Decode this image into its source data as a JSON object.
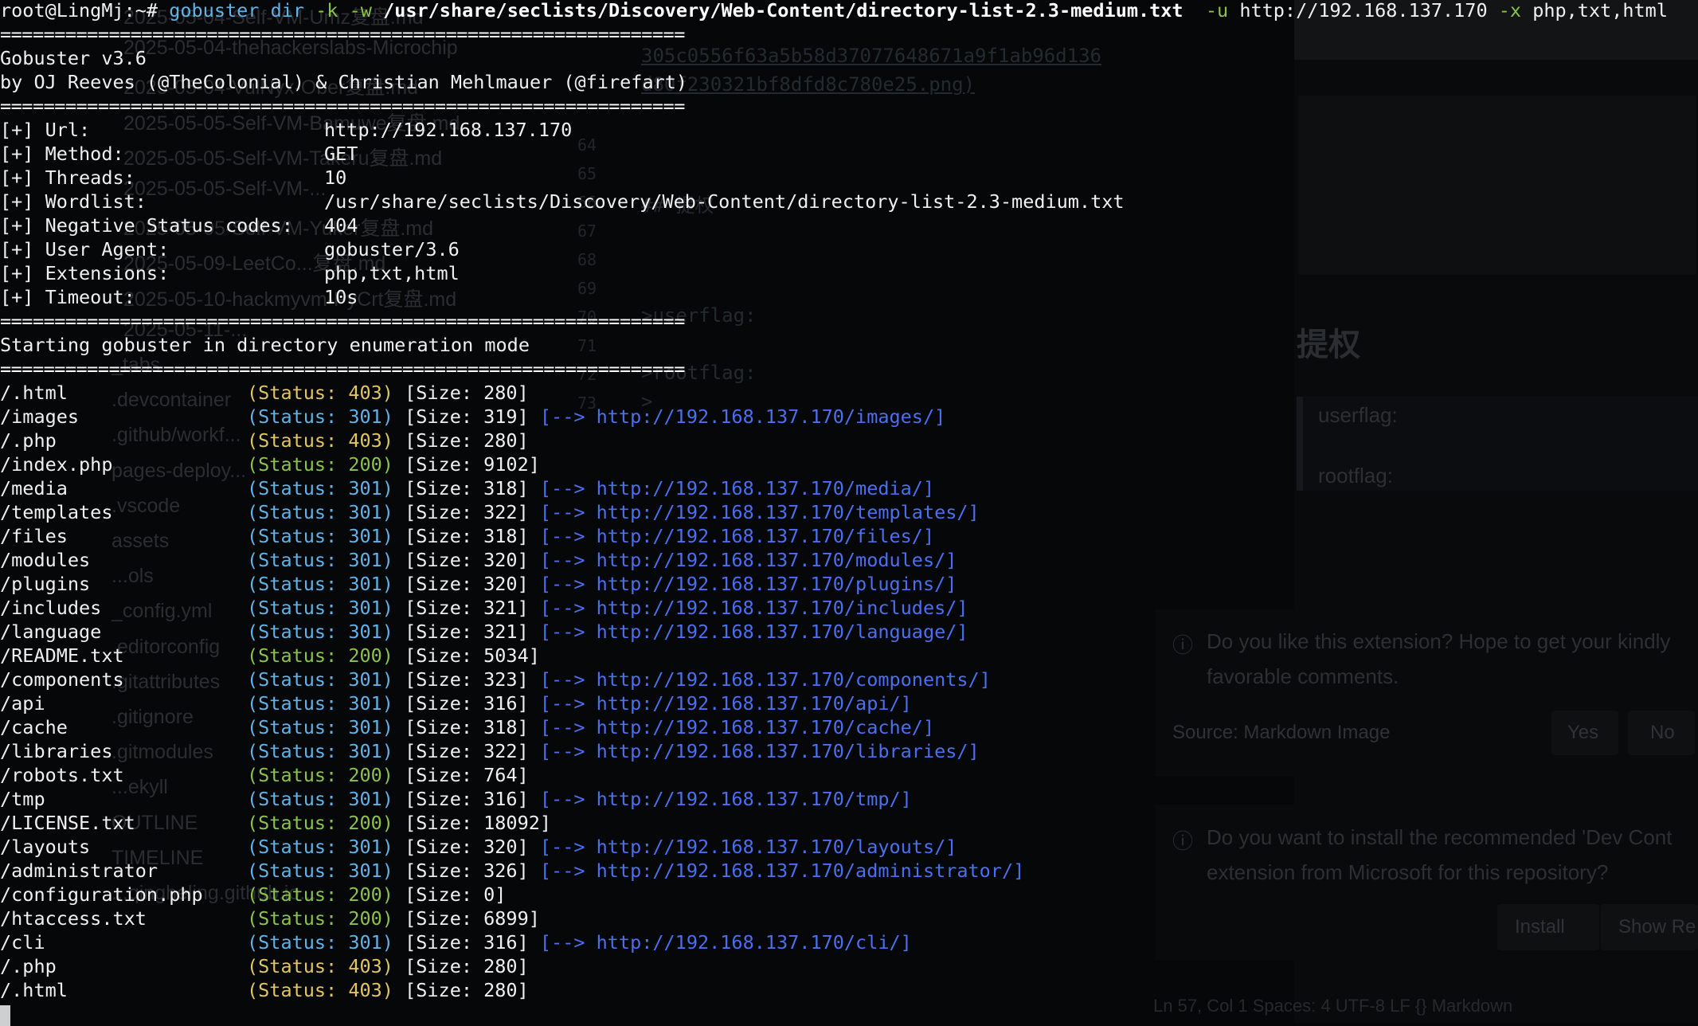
{
  "command": {
    "prompt": "root@LingMj:~# ",
    "tool": "gobuster dir",
    "flags1": " -k -w ",
    "wordlist": "/usr/share/seclists/Discovery/Web-Content/directory-list-2.3-medium.txt",
    "flag_u": "  -u ",
    "url": "http://192.168.137.170",
    "flag_x": " -x ",
    "extensions": "php,txt,html"
  },
  "separator": "===============================================================",
  "banner": {
    "version": "Gobuster v3.6",
    "credits": "by OJ Reeves (@TheColonial) & Christian Mehlmauer (@firefart)"
  },
  "config": [
    {
      "key": "[+] Url:",
      "value": "http://192.168.137.170"
    },
    {
      "key": "[+] Method:",
      "value": "GET"
    },
    {
      "key": "[+] Threads:",
      "value": "10"
    },
    {
      "key": "[+] Wordlist:",
      "value": "/usr/share/seclists/Discovery/Web-Content/directory-list-2.3-medium.txt"
    },
    {
      "key": "[+] Negative Status codes:",
      "value": "404"
    },
    {
      "key": "[+] User Agent:",
      "value": "gobuster/3.6"
    },
    {
      "key": "[+] Extensions:",
      "value": "php,txt,html"
    },
    {
      "key": "[+] Timeout:",
      "value": "10s"
    }
  ],
  "mode_line": "Starting gobuster in directory enumeration mode",
  "status_colors": {
    "200": "#8bc34a",
    "301": "#5fb3e8",
    "403": "#e2c65c"
  },
  "results": [
    {
      "path": "/.html",
      "status": "403",
      "size": "280",
      "redirect": ""
    },
    {
      "path": "/images",
      "status": "301",
      "size": "319",
      "redirect": "http://192.168.137.170/images/"
    },
    {
      "path": "/.php",
      "status": "403",
      "size": "280",
      "redirect": ""
    },
    {
      "path": "/index.php",
      "status": "200",
      "size": "9102",
      "redirect": ""
    },
    {
      "path": "/media",
      "status": "301",
      "size": "318",
      "redirect": "http://192.168.137.170/media/"
    },
    {
      "path": "/templates",
      "status": "301",
      "size": "322",
      "redirect": "http://192.168.137.170/templates/"
    },
    {
      "path": "/files",
      "status": "301",
      "size": "318",
      "redirect": "http://192.168.137.170/files/"
    },
    {
      "path": "/modules",
      "status": "301",
      "size": "320",
      "redirect": "http://192.168.137.170/modules/"
    },
    {
      "path": "/plugins",
      "status": "301",
      "size": "320",
      "redirect": "http://192.168.137.170/plugins/"
    },
    {
      "path": "/includes",
      "status": "301",
      "size": "321",
      "redirect": "http://192.168.137.170/includes/"
    },
    {
      "path": "/language",
      "status": "301",
      "size": "321",
      "redirect": "http://192.168.137.170/language/"
    },
    {
      "path": "/README.txt",
      "status": "200",
      "size": "5034",
      "redirect": ""
    },
    {
      "path": "/components",
      "status": "301",
      "size": "323",
      "redirect": "http://192.168.137.170/components/"
    },
    {
      "path": "/api",
      "status": "301",
      "size": "316",
      "redirect": "http://192.168.137.170/api/"
    },
    {
      "path": "/cache",
      "status": "301",
      "size": "318",
      "redirect": "http://192.168.137.170/cache/"
    },
    {
      "path": "/libraries",
      "status": "301",
      "size": "322",
      "redirect": "http://192.168.137.170/libraries/"
    },
    {
      "path": "/robots.txt",
      "status": "200",
      "size": "764",
      "redirect": ""
    },
    {
      "path": "/tmp",
      "status": "301",
      "size": "316",
      "redirect": "http://192.168.137.170/tmp/"
    },
    {
      "path": "/LICENSE.txt",
      "status": "200",
      "size": "18092",
      "redirect": ""
    },
    {
      "path": "/layouts",
      "status": "301",
      "size": "320",
      "redirect": "http://192.168.137.170/layouts/"
    },
    {
      "path": "/administrator",
      "status": "301",
      "size": "326",
      "redirect": "http://192.168.137.170/administrator/"
    },
    {
      "path": "/configuration.php",
      "status": "200",
      "size": "0",
      "redirect": ""
    },
    {
      "path": "/htaccess.txt",
      "status": "200",
      "size": "6899",
      "redirect": ""
    },
    {
      "path": "/cli",
      "status": "301",
      "size": "316",
      "redirect": "http://192.168.137.170/cli/"
    },
    {
      "path": "/.php",
      "status": "403",
      "size": "280",
      "redirect": ""
    },
    {
      "path": "/.html",
      "status": "403",
      "size": "280",
      "redirect": ""
    }
  ],
  "background": {
    "explorer_files": [
      "2025-05-04-Self-VM-Umz复盘.md",
      "2025-05-04-thehackerslabs-Microchip",
      "2025-05-04-VulNyx-Ober复盘.md",
      "2025-05-05-Self-VM-Bamuwe复盘.md",
      "2025-05-05-Self-VM-Takeru复盘.md",
      "2025-05-05-Self-VM-...",
      "2025-05-05-Self-VM-Yuker复盘.md",
      "2025-05-09-LeetCo...复盘.md",
      "2025-05-10-hackmyvm-PyCrt复盘.md",
      "2025-05-11-...",
      "_tabs",
      ".devcontainer",
      ".github/workf...",
      "pages-deploy...",
      ".vscode",
      "assets",
      "...ols",
      "_config.yml",
      ".editorconfig",
      ".gitattributes",
      ".gitignore",
      ".gitmodules",
      "...ekyll",
      "OUTLINE",
      "TIMELINE",
      "...qingheling.github.io..."
    ],
    "line_numbers": [
      "64",
      "65",
      "66",
      "67",
      "68",
      "69",
      "70",
      "71",
      "72",
      "73"
    ],
    "md_hash": "305c0556f63a5b58d37077648671a9f1ab96d136",
    "md_png": "d80f230321bf8dfd8c780e25.png)",
    "md_heading": "## 提权",
    "md_user": ">userflag:",
    "md_root": ">rootflag:",
    "md_gt": ">",
    "preview_heading": "提权",
    "preview_user": "userflag:",
    "preview_root": "rootflag:",
    "notif1_text_1": "Do you like this extension? Hope to get your kindly",
    "notif1_text_2": "favorable comments.",
    "notif1_source": "Source: Markdown Image",
    "notif1_yes": "Yes",
    "notif1_no": "No",
    "notif2_text_1": "Do you want to install the recommended 'Dev Cont",
    "notif2_text_2": "extension from Microsoft for this repository?",
    "notif2_install": "Install",
    "notif2_show": "Show Re",
    "statusbar": "Ln 57, Col 1    Spaces: 4    UTF-8    LF    {} Markdown"
  }
}
